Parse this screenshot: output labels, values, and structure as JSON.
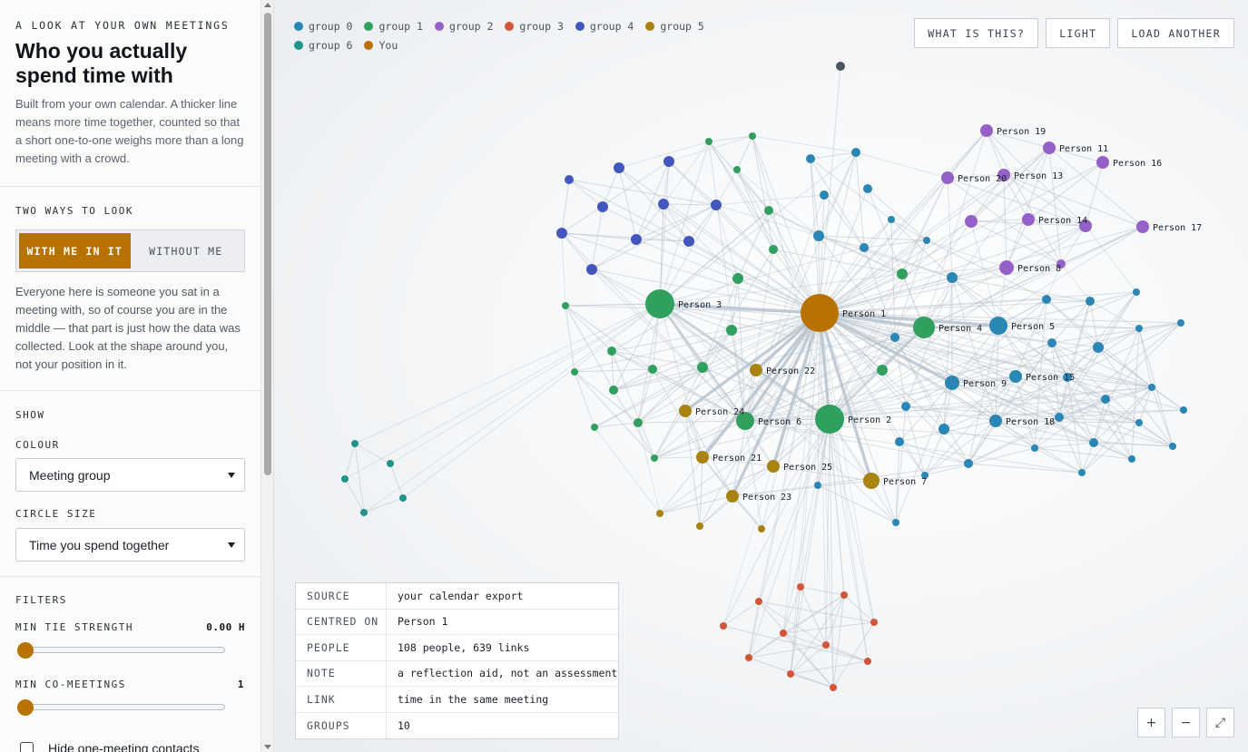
{
  "sidebar": {
    "kicker": "A LOOK AT YOUR OWN MEETINGS",
    "title": "Who you actually spend time with",
    "description": "Built from your own calendar. A thicker line means more time together, counted so that a short one-to-one weighs more than a long meeting with a crowd.",
    "ways": {
      "heading": "TWO WAYS TO LOOK",
      "with_label": "WITH ME IN IT",
      "without_label": "WITHOUT ME",
      "selected": "WITH ME IN IT",
      "explanation": "Everyone here is someone you sat in a meeting with, so of course you are in the middle — that part is just how the data was collected. Look at the shape around you, not your position in it."
    },
    "show": {
      "heading": "SHOW",
      "colour_label": "COLOUR",
      "colour_value": "Meeting group",
      "size_label": "CIRCLE SIZE",
      "size_value": "Time you spend together"
    },
    "filters": {
      "heading": "FILTERS",
      "tie_label": "MIN TIE STRENGTH",
      "tie_value": "0.00 H",
      "tie_fraction": 0,
      "co_label": "MIN CO-MEETINGS",
      "co_value": "1",
      "co_fraction": 0,
      "hide_label": "Hide one-meeting contacts",
      "hide_checked": false
    }
  },
  "legend": [
    {
      "label": "group 0",
      "color": "#2a86b4"
    },
    {
      "label": "group 1",
      "color": "#31a05f"
    },
    {
      "label": "group 2",
      "color": "#9561c8"
    },
    {
      "label": "group 3",
      "color": "#d2553a"
    },
    {
      "label": "group 4",
      "color": "#4257bd"
    },
    {
      "label": "group 5",
      "color": "#a88312"
    },
    {
      "label": "group 6",
      "color": "#1f9488"
    },
    {
      "label": "You",
      "color": "#b87200"
    }
  ],
  "toolbar": {
    "what_label": "WHAT IS THIS?",
    "light_label": "LIGHT",
    "load_label": "LOAD ANOTHER"
  },
  "info": {
    "rows": [
      {
        "k": "SOURCE",
        "v": "your calendar export"
      },
      {
        "k": "CENTRED ON",
        "v": "Person 1"
      },
      {
        "k": "PEOPLE",
        "v": "108 people, 639 links"
      },
      {
        "k": "NOTE",
        "v": "a reflection aid, not an assessment"
      },
      {
        "k": "LINK",
        "v": "time in the same meeting"
      },
      {
        "k": "GROUPS",
        "v": "10"
      }
    ]
  },
  "zoom": {
    "in": "+",
    "out": "−",
    "fit": "⤢"
  },
  "colors": {
    "accent": "#b87200",
    "edge": "#b6c2cc",
    "extra_group": "#4a5561"
  },
  "graph_labels": [
    "Person 1",
    "Person 2",
    "Person 3",
    "Person 4",
    "Person 5",
    "Person 6",
    "Person 7",
    "Person 8",
    "Person 9",
    "Person 11",
    "Person 13",
    "Person 14",
    "Person 15",
    "Person 16",
    "Person 17",
    "Person 18",
    "Person 19",
    "Person 20",
    "Person 21",
    "Person 22",
    "Person 23",
    "Person 24",
    "Person 25"
  ]
}
